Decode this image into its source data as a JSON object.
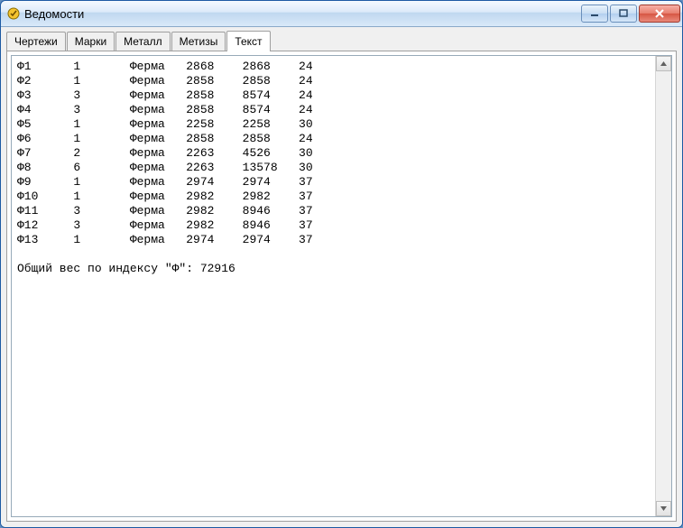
{
  "window": {
    "title": "Ведомости"
  },
  "tabs": {
    "items": [
      {
        "label": "Чертежи",
        "active": false
      },
      {
        "label": "Марки",
        "active": false
      },
      {
        "label": "Металл",
        "active": false
      },
      {
        "label": "Метизы",
        "active": false
      },
      {
        "label": "Текст",
        "active": true
      }
    ]
  },
  "text": {
    "rows": [
      {
        "c0": "Ф1",
        "c1": "1",
        "c2": "Ферма",
        "c3": "2868",
        "c4": "2868",
        "c5": "24"
      },
      {
        "c0": "Ф2",
        "c1": "1",
        "c2": "Ферма",
        "c3": "2858",
        "c4": "2858",
        "c5": "24"
      },
      {
        "c0": "Ф3",
        "c1": "3",
        "c2": "Ферма",
        "c3": "2858",
        "c4": "8574",
        "c5": "24"
      },
      {
        "c0": "Ф4",
        "c1": "3",
        "c2": "Ферма",
        "c3": "2858",
        "c4": "8574",
        "c5": "24"
      },
      {
        "c0": "Ф5",
        "c1": "1",
        "c2": "Ферма",
        "c3": "2258",
        "c4": "2258",
        "c5": "30"
      },
      {
        "c0": "Ф6",
        "c1": "1",
        "c2": "Ферма",
        "c3": "2858",
        "c4": "2858",
        "c5": "24"
      },
      {
        "c0": "Ф7",
        "c1": "2",
        "c2": "Ферма",
        "c3": "2263",
        "c4": "4526",
        "c5": "30"
      },
      {
        "c0": "Ф8",
        "c1": "6",
        "c2": "Ферма",
        "c3": "2263",
        "c4": "13578",
        "c5": "30"
      },
      {
        "c0": "Ф9",
        "c1": "1",
        "c2": "Ферма",
        "c3": "2974",
        "c4": "2974",
        "c5": "37"
      },
      {
        "c0": "Ф10",
        "c1": "1",
        "c2": "Ферма",
        "c3": "2982",
        "c4": "2982",
        "c5": "37"
      },
      {
        "c0": "Ф11",
        "c1": "3",
        "c2": "Ферма",
        "c3": "2982",
        "c4": "8946",
        "c5": "37"
      },
      {
        "c0": "Ф12",
        "c1": "3",
        "c2": "Ферма",
        "c3": "2982",
        "c4": "8946",
        "c5": "37"
      },
      {
        "c0": "Ф13",
        "c1": "1",
        "c2": "Ферма",
        "c3": "2974",
        "c4": "2974",
        "c5": "37"
      }
    ],
    "summary": "Общий вес по индексу \"Ф\": 72916"
  }
}
